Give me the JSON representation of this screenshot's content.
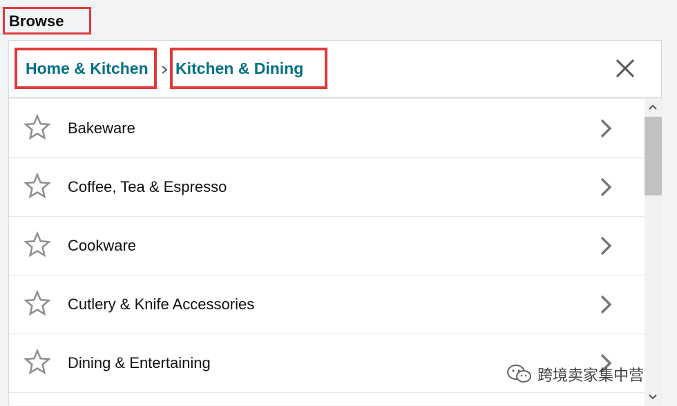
{
  "header": {
    "title": "Browse"
  },
  "breadcrumb": {
    "items": [
      {
        "label": "Home & Kitchen"
      },
      {
        "label": "Kitchen & Dining"
      }
    ],
    "separator_icon": "chevron-right-icon",
    "close_icon": "close-icon"
  },
  "categories": [
    {
      "label": "Bakeware"
    },
    {
      "label": "Coffee, Tea & Espresso"
    },
    {
      "label": "Cookware"
    },
    {
      "label": "Cutlery & Knife Accessories"
    },
    {
      "label": "Dining & Entertaining"
    }
  ],
  "watermark": {
    "text": "跨境卖家集中营",
    "icon": "wechat-icon"
  },
  "colors": {
    "link": "#007185",
    "highlight_border": "#e03a3a",
    "icon_gray": "#8a8f8f"
  }
}
